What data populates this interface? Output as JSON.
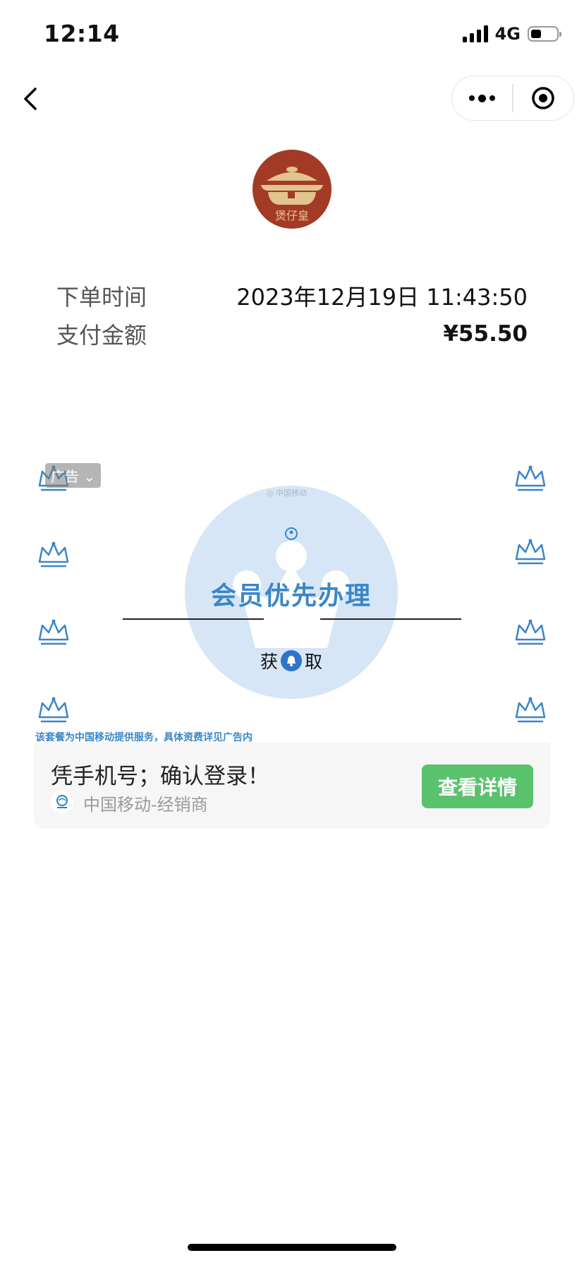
{
  "status_bar": {
    "time": "12:14",
    "network": "4G",
    "battery_level": 0.4
  },
  "nav": {
    "back_icon": "chevron-left-icon",
    "more_icon": "more-dots-icon",
    "close_icon": "target-circle-icon"
  },
  "merchant": {
    "logo_text": "煲仔皇",
    "logo_colors": {
      "bg": "#a23a25",
      "pot": "#e2c48e"
    }
  },
  "order": {
    "time_label": "下单时间",
    "time_value": "2023年12月19日 11:43:50",
    "amount_label": "支付金额",
    "amount_value": "¥55.50"
  },
  "ad": {
    "badge": "广告",
    "brand_small": "中国移动",
    "title": "会员优先办理",
    "get_left": "获",
    "get_right": "取",
    "disclaimer": "该套餐为中国移动提供服务，具体资费详见广告内",
    "headline": "凭手机号；确认登录！",
    "advertiser": "中国移动-经销商",
    "cta": "查看详情",
    "colors": {
      "accent": "#3a86c8",
      "circle": "#d6e6f6",
      "cta": "#5ac16d"
    }
  }
}
